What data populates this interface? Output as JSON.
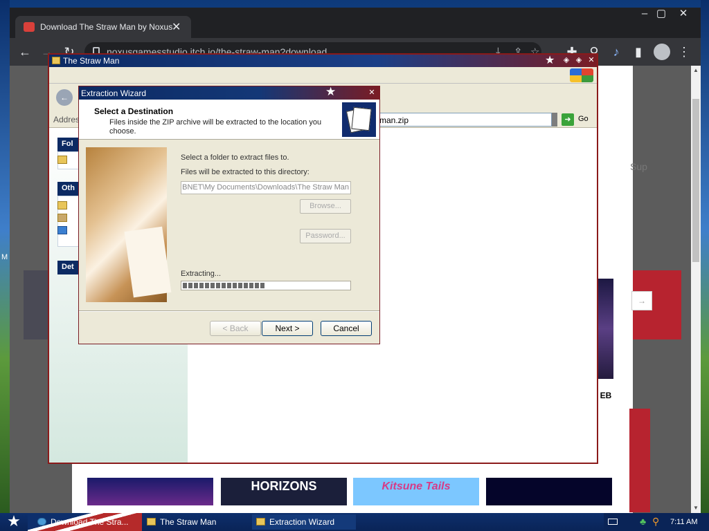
{
  "browser": {
    "tab_title": "Download The Straw Man by Noxus",
    "url": "noxusgamesstudio.itch.io/the-straw-man?download",
    "page_snippet": "Sup",
    "page_badge": "EB",
    "game_cards": [
      "",
      "HORIZONS",
      "Kitsune Tails",
      ""
    ]
  },
  "explorer": {
    "title": "The Straw Man",
    "address_label": "Address",
    "address_value": "man.zip",
    "go_label": "Go",
    "taskbox_labels": [
      "Fol",
      "Oth",
      "Det"
    ]
  },
  "wizard": {
    "title": "Extraction Wizard",
    "header_title": "Select a Destination",
    "header_subtitle": "Files inside the ZIP archive will be extracted to the location you choose.",
    "line1": "Select a folder to extract files to.",
    "line2": "Files will be extracted to this directory:",
    "destination": "BNET\\My Documents\\Downloads\\The Straw Man",
    "browse_label": "Browse...",
    "password_label": "Password...",
    "status": "Extracting...",
    "progress_fraction": 0.5,
    "back_label": "< Back",
    "next_label": "Next >",
    "cancel_label": "Cancel"
  },
  "taskbar": {
    "items": [
      "Download The Stra...",
      "The Straw Man",
      "Extraction Wizard"
    ],
    "clock": "7:11 AM"
  },
  "desktop_letter": "M"
}
